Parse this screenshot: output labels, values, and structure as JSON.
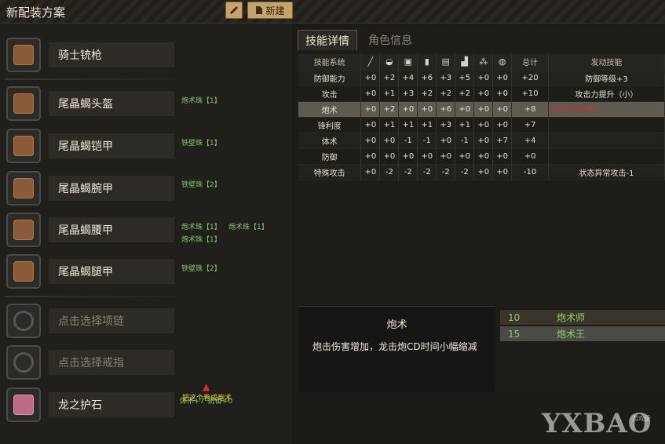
{
  "window": {
    "title": "新配装方案",
    "new_label": "新建"
  },
  "slots": [
    {
      "name": "骑士铳枪",
      "decorations": []
    },
    {
      "name": "尾晶蝎头盔",
      "decorations": [
        "炮术珠【1】"
      ]
    },
    {
      "name": "尾晶蝎铠甲",
      "decorations": [
        "铁壁珠【1】"
      ]
    },
    {
      "name": "尾晶蝎腕甲",
      "decorations": [
        "铁壁珠【2】"
      ]
    },
    {
      "name": "尾晶蝎腰甲",
      "decorations": [
        "炮术珠【1】",
        "炮术珠【1】",
        "炮术珠【1】"
      ]
    },
    {
      "name": "尾晶蝎腿甲",
      "decorations": [
        "铁壁珠【2】"
      ]
    },
    {
      "name": "点击选择项链",
      "decorations": []
    },
    {
      "name": "点击选择戒指",
      "decorations": []
    },
    {
      "name": "龙之护石",
      "decorations": [
        "体术+7",
        "防御+0"
      ]
    }
  ],
  "annotation": {
    "note": "把这个看成炮术"
  },
  "tabs": [
    {
      "label": "技能详情",
      "active": true
    },
    {
      "label": "角色信息",
      "active": false
    }
  ],
  "skills_table": {
    "headers": {
      "skill": "技能系统",
      "total": "总计",
      "effect": "发动技能"
    },
    "column_icons": [
      "weapon-icon",
      "head-icon",
      "chest-icon",
      "arm-icon",
      "waist-icon",
      "leg-icon",
      "charm-icon",
      "decoration-icon"
    ],
    "rows": [
      {
        "name": "防御能力",
        "values": [
          "+0",
          "+2",
          "+4",
          "+6",
          "+3",
          "+5",
          "+0",
          "+0"
        ],
        "total": "+20",
        "effect": "防御等级+3"
      },
      {
        "name": "攻击",
        "values": [
          "+0",
          "+1",
          "+3",
          "+2",
          "+2",
          "+2",
          "+0",
          "+0"
        ],
        "total": "+10",
        "effect": "攻击力提升（小）"
      },
      {
        "name": "炮术",
        "values": [
          "+0",
          "+2",
          "+0",
          "+0",
          "+6",
          "+0",
          "+0",
          "+0"
        ],
        "total": "+8",
        "effect": "",
        "bonus": "总值15还好出炮王",
        "selected": true
      },
      {
        "name": "锋利度",
        "values": [
          "+0",
          "+1",
          "+1",
          "+1",
          "+3",
          "+1",
          "+0",
          "+0"
        ],
        "total": "+7",
        "effect": ""
      },
      {
        "name": "体术",
        "values": [
          "+0",
          "+0",
          "-1",
          "-1",
          "+0",
          "-1",
          "+0",
          "+7"
        ],
        "total": "+4",
        "effect": ""
      },
      {
        "name": "防御",
        "values": [
          "+0",
          "+0",
          "+0",
          "+0",
          "+0",
          "+0",
          "+0",
          "+0"
        ],
        "total": "+0",
        "effect": ""
      },
      {
        "name": "特殊攻击",
        "values": [
          "+0",
          "-2",
          "-2",
          "-2",
          "-2",
          "-2",
          "+0",
          "+0"
        ],
        "total": "-10",
        "effect": "状态异常攻击-1"
      }
    ]
  },
  "skill_detail": {
    "title": "炮术",
    "description": "炮击伤害增加，龙击炮CD时间小幅缩减"
  },
  "skill_levels": [
    {
      "points": "10",
      "name": "炮术师"
    },
    {
      "points": "15",
      "name": "炮术王"
    }
  ],
  "watermark": {
    "text": "YXBAO",
    "sub": "游戏堡"
  },
  "colors": {
    "accent_button": "#c5a36a",
    "decoration_text": "#7fc66a",
    "bonus_red": "#e02a2a",
    "note_yellow": "#e8d43c"
  }
}
